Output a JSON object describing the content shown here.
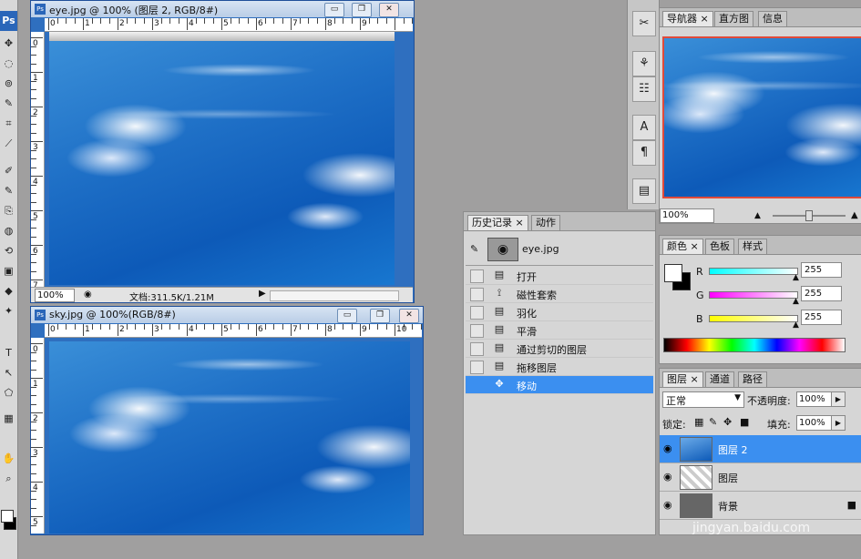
{
  "tools": {
    "logo": "Ps",
    "items": [
      "✥",
      "◌",
      "⊚",
      "✎",
      "⌗",
      "⟋",
      "✐",
      "✎",
      "⎘",
      "◍",
      "⟲",
      "▣",
      "◆",
      "✦",
      "T",
      "↖",
      "⬠",
      "▦",
      "✋",
      "⌕"
    ]
  },
  "eye_window": {
    "title": "eye.jpg @ 100% (图层 2, RGB/8#)",
    "buttons": {
      "minimize": "▭",
      "restore": "❐",
      "close": "✕"
    },
    "ruler_h": [
      "0",
      "1",
      "2",
      "3",
      "4",
      "5",
      "6",
      "7",
      "8",
      "9"
    ],
    "ruler_v": [
      "0",
      "1",
      "2",
      "3",
      "4",
      "5",
      "6",
      "7"
    ],
    "zoom": "100%",
    "doc_info": "文档:311.5K/1.21M",
    "arrow": "▶"
  },
  "sky_window": {
    "title": "sky.jpg @ 100%(RGB/8#)",
    "buttons": {
      "minimize": "▭",
      "restore": "❐",
      "close": "✕"
    },
    "ruler_h": [
      "0",
      "1",
      "2",
      "3",
      "4",
      "5",
      "6",
      "7",
      "8",
      "9",
      "10"
    ],
    "ruler_v": [
      "0",
      "1",
      "2",
      "3",
      "4",
      "5"
    ]
  },
  "history_panel": {
    "tabs": [
      "历史记录 ×",
      "动作"
    ],
    "snapshot": "eye.jpg",
    "items": [
      {
        "icon": "▤",
        "label": "打开"
      },
      {
        "icon": "⟟",
        "label": "磁性套索"
      },
      {
        "icon": "▤",
        "label": "羽化"
      },
      {
        "icon": "▤",
        "label": "平滑"
      },
      {
        "icon": "▤",
        "label": "通过剪切的图层"
      },
      {
        "icon": "▤",
        "label": "拖移图层"
      },
      {
        "icon": "✥",
        "label": "移动",
        "selected": true
      }
    ]
  },
  "navigator_panel": {
    "tabs": [
      "导航器 ×",
      "直方图",
      "信息"
    ],
    "zoom": "100%"
  },
  "color_panel": {
    "tabs": [
      "颜色 ×",
      "色板",
      "样式"
    ],
    "channels": [
      {
        "label": "R",
        "value": "255"
      },
      {
        "label": "G",
        "value": "255"
      },
      {
        "label": "B",
        "value": "255"
      }
    ]
  },
  "layers_panel": {
    "tabs": [
      "图层 ×",
      "通道",
      "路径"
    ],
    "blend_mode": "正常",
    "opacity_label": "不透明度:",
    "opacity": "100%",
    "lock_label": "锁定:",
    "fill_label": "填充:",
    "fill": "100%",
    "layers": [
      {
        "name": "图层 2",
        "selected": true
      },
      {
        "name": "图层"
      },
      {
        "name": "背景"
      }
    ]
  },
  "dock_icons": [
    "✂",
    "⚘",
    "☷",
    "A",
    "¶",
    "▤"
  ],
  "watermark": "jingyan.baidu.com"
}
